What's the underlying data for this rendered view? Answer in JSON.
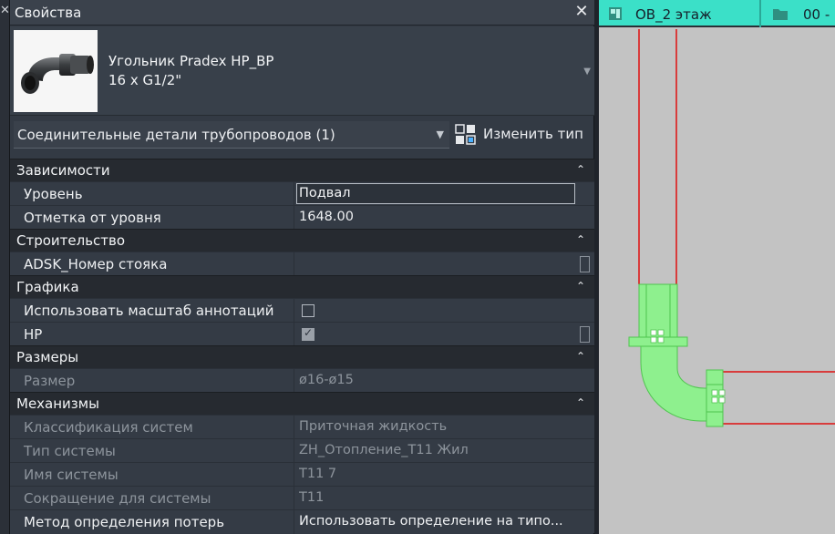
{
  "panel": {
    "title": "Свойства",
    "close_glyph": "✕",
    "left_close_glyph": "✕"
  },
  "type_selector": {
    "name_line1": "Угольник Pradex HP_BP",
    "name_line2": "16 x G1/2\"",
    "dropdown_glyph": "▼"
  },
  "category_filter": {
    "label": "Соединительные детали трубопроводов (1)",
    "chevron": "⌄",
    "edit_type_label": "Изменить тип"
  },
  "sections": [
    {
      "title": "Зависимости",
      "rows": [
        {
          "label": "Уровень",
          "value": "Подвал",
          "kind": "edit"
        },
        {
          "label": "Отметка от уровня",
          "value": "1648.00",
          "kind": "text"
        }
      ]
    },
    {
      "title": "Строительство",
      "rows": [
        {
          "label": "ADSK_Номер стояка",
          "value": "",
          "kind": "param"
        }
      ]
    },
    {
      "title": "Графика",
      "rows": [
        {
          "label": "Использовать масштаб аннотаций",
          "checked": false,
          "kind": "check"
        },
        {
          "label": "HP",
          "checked": true,
          "kind": "check-param"
        }
      ]
    },
    {
      "title": "Размеры",
      "rows": [
        {
          "label": "Размер",
          "value": "ø16-ø15",
          "kind": "dim"
        }
      ]
    },
    {
      "title": "Механизмы",
      "rows": [
        {
          "label": "Классификация систем",
          "value": "Приточная жидкость",
          "kind": "dim"
        },
        {
          "label": "Тип системы",
          "value": "ZH_Отопление_T11 Жил",
          "kind": "dim"
        },
        {
          "label": "Имя системы",
          "value": "T11 7",
          "kind": "dim"
        },
        {
          "label": "Сокращение для системы",
          "value": "T11",
          "kind": "dim"
        },
        {
          "label": "Метод определения потерь",
          "value": "Использовать определение на типо...",
          "kind": "text"
        }
      ]
    }
  ],
  "view": {
    "tab1_label": "ОВ_2 этаж",
    "tab2_label": "00 -",
    "colors": {
      "tab_bg": "#3be0c8",
      "pipe_outline": "#e01010",
      "fitting_fill": "#8ef08e",
      "canvas_bg": "#c3c3c3"
    }
  },
  "icons": {
    "section_collapse": "chevron-double-up-icon",
    "edit_type": "edit-type-icon",
    "view_tab": "floor-plan-icon"
  }
}
